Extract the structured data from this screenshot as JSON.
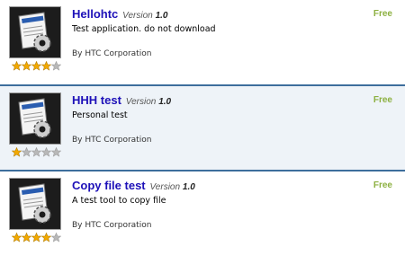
{
  "colors": {
    "accent": "#3d6e9c",
    "title": "#1d10b8",
    "free": "#8cb040",
    "star_on": "#f2a900",
    "star_off": "#b8b8b8"
  },
  "apps": [
    {
      "name": "Hellohtc",
      "version_label": "Version",
      "version": "1.0",
      "description": "Test application. do not download",
      "author": "By HTC Corporation",
      "price": "Free",
      "rating": 4,
      "rating_max": 5
    },
    {
      "name": "HHH test",
      "version_label": "Version",
      "version": "1.0",
      "description": "Personal test",
      "author": "By HTC Corporation",
      "price": "Free",
      "rating": 1,
      "rating_max": 5
    },
    {
      "name": "Copy file test",
      "version_label": "Version",
      "version": "1.0",
      "description": "A test tool to copy file",
      "author": "By HTC Corporation",
      "price": "Free",
      "rating": 4,
      "rating_max": 5
    }
  ]
}
